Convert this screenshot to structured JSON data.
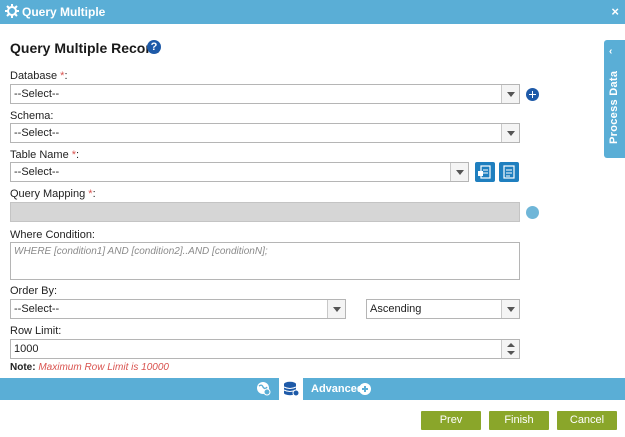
{
  "window": {
    "title": "Query Multiple",
    "close_glyph": "×"
  },
  "heading": "Query Multiple Record",
  "help_glyph": "?",
  "required_mark": "*",
  "database": {
    "label": "Database",
    "suffix": ":",
    "value": "--Select--"
  },
  "schema": {
    "label": "Schema:",
    "value": "--Select--"
  },
  "table_name": {
    "label": "Table Name",
    "suffix": ":",
    "value": "--Select--"
  },
  "query_mapping": {
    "label": "Query Mapping",
    "suffix": ":"
  },
  "where_condition": {
    "label": "Where Condition:",
    "placeholder": "WHERE [condition1] AND [condition2]..AND [conditionN];"
  },
  "order_by": {
    "label": "Order By:",
    "value": "--Select--",
    "direction": "Ascending"
  },
  "row_limit": {
    "label": "Row Limit:",
    "value": "1000"
  },
  "note": {
    "label": "Note:",
    "message": "Maximum Row Limit is 10000"
  },
  "side_panel": {
    "label": "Process Data",
    "chevron": "‹"
  },
  "advanced": {
    "label": "Advanced"
  },
  "buttons": {
    "prev": "Prev",
    "finish": "Finish",
    "cancel": "Cancel"
  },
  "colors": {
    "header": "#5aaed6",
    "button": "#8aa62a",
    "accent_blue": "#1e5aa8",
    "required": "#d9534f"
  }
}
